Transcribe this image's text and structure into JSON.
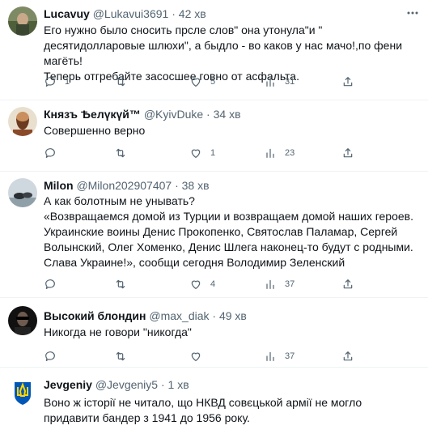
{
  "tweets": [
    {
      "name": "Lucavuy",
      "handle": "@Lukavui3691",
      "dot": "·",
      "time": "42 хв",
      "text": "Его нужно было сносить прсле слов\" она утонула\"и \" десятидолларовые шлюхи\", а быдло - во каков у нас мачо!,по фени магёть!\nТеперь отгребайте засосшее говно от асфальта.",
      "replies": "1",
      "retweets": "",
      "likes": "5",
      "views": "31"
    },
    {
      "name": "Князъ Ѣелүкүй™",
      "handle": "@KyivDuke",
      "dot": "·",
      "time": "34 хв",
      "text": "Совершенно верно",
      "replies": "",
      "retweets": "",
      "likes": "1",
      "views": "23"
    },
    {
      "name": "Milon",
      "handle": "@Milon202907407",
      "dot": "·",
      "time": "38 хв",
      "text": "А как болотным не унывать?\n«Возвращаемся домой из Турции и возвращаем домой наших героев. Украинские воины Денис Прокопенко, Святослав Паламар, Сергей Волынский, Олег Хоменко, Денис Шлега наконец-то будут с родными. Слава Украине!», сообщи сегодня Володимир Зеленский",
      "replies": "",
      "retweets": "",
      "likes": "4",
      "views": "37"
    },
    {
      "name": "Высокий блондин",
      "handle": "@max_diak",
      "dot": "·",
      "time": "49 хв",
      "text": "Никогда не говори \"никогда\"",
      "replies": "",
      "retweets": "",
      "likes": "",
      "views": "37"
    },
    {
      "name": "Jevgeniy",
      "handle": "@Jevgeniy5",
      "dot": "·",
      "time": "1 хв",
      "text": "Воно ж історії не читало, що НКВД совєцькой армії не могло придавити бандер з 1941 до 1956 року.",
      "replies": "",
      "retweets": "",
      "likes": "",
      "views": ""
    }
  ],
  "colors": {
    "text": "#0f1419",
    "secondary": "#536471",
    "divider": "#eff3f4"
  },
  "icons": [
    "more-icon",
    "reply-icon",
    "retweet-icon",
    "like-icon",
    "views-icon",
    "share-icon"
  ]
}
